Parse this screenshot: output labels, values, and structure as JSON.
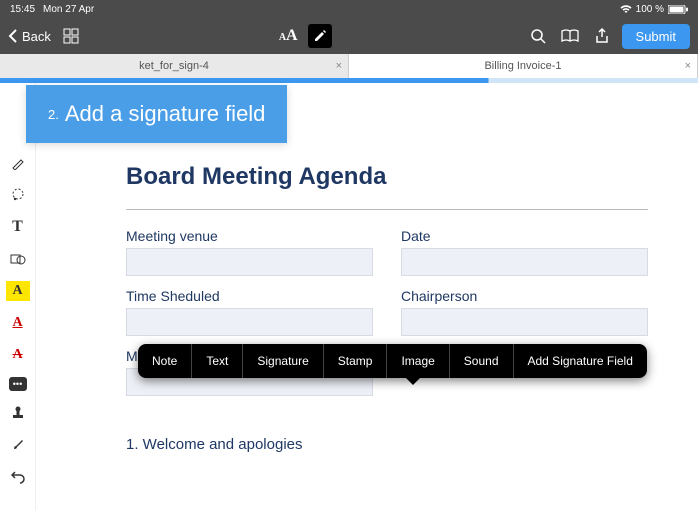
{
  "statusbar": {
    "time": "15:45",
    "date": "Mon 27 Apr",
    "battery": "100 %"
  },
  "topbar": {
    "back": "Back",
    "submit": "Submit"
  },
  "tabs": [
    {
      "label": "ket_for_sign-4"
    },
    {
      "label": "Billing Invoice-1"
    }
  ],
  "callout": {
    "num": "2.",
    "text": "Add a signature field"
  },
  "doc": {
    "title": "Board Meeting Agenda",
    "fields": {
      "venue": "Meeting venue",
      "date": "Date",
      "time": "Time Sheduled",
      "chair": "Chairperson",
      "m": "M"
    },
    "agenda_item_1": "1.  Welcome and apologies"
  },
  "popup": {
    "note": "Note",
    "text": "Text",
    "signature": "Signature",
    "stamp": "Stamp",
    "image": "Image",
    "sound": "Sound",
    "add_sig_field": "Add Signature Field"
  }
}
